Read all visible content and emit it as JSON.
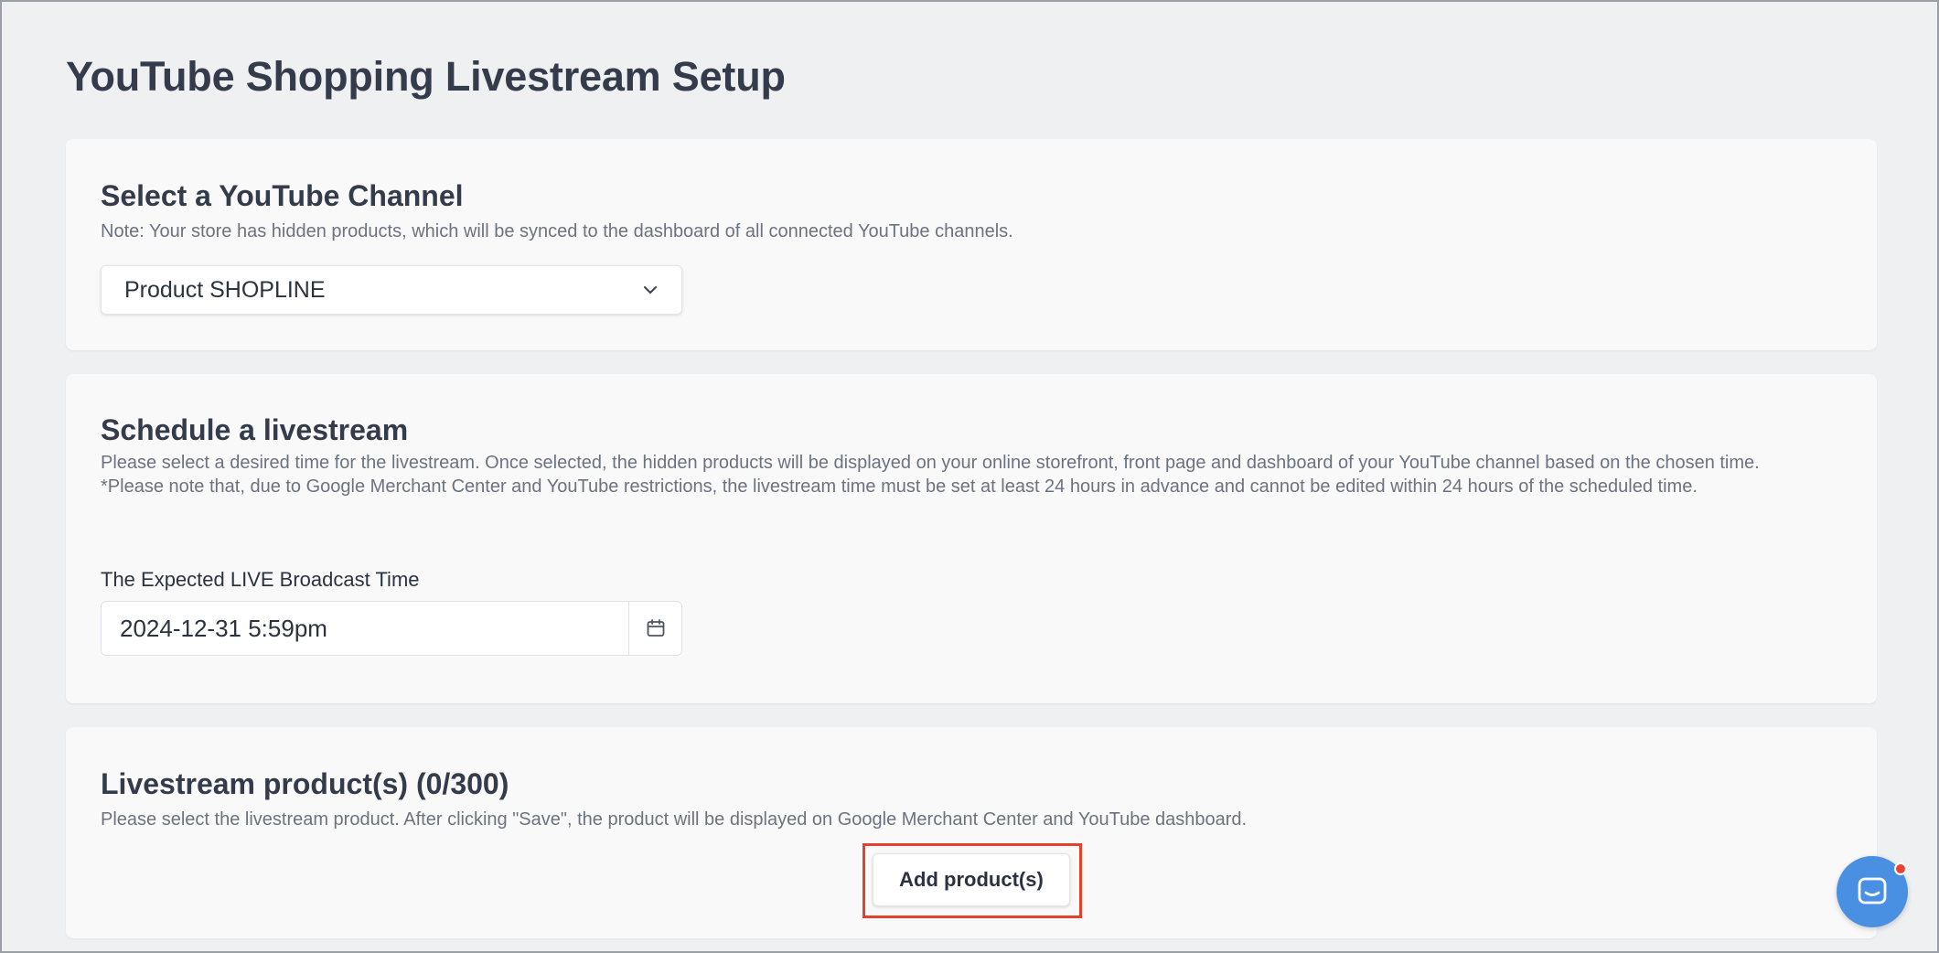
{
  "page": {
    "title": "YouTube Shopping Livestream Setup"
  },
  "channel": {
    "heading": "Select a YouTube Channel",
    "note": "Note: Your store has hidden products, which will be synced to the dashboard of all connected YouTube channels.",
    "selected": "Product SHOPLINE",
    "icon": "chevron-down-icon"
  },
  "schedule": {
    "heading": "Schedule a livestream",
    "description": "Please select a desired time for the livestream. Once selected, the hidden products will be displayed on your online storefront, front page and dashboard of your YouTube channel based on the chosen time.",
    "restriction": "*Please note that, due to Google Merchant Center and YouTube restrictions, the livestream time must be set at least 24 hours in advance and cannot be edited within 24 hours of the scheduled time.",
    "field_label": "The Expected LIVE Broadcast Time",
    "value": "2024-12-31 5:59pm",
    "icon": "calendar-icon"
  },
  "products": {
    "heading": "Livestream product(s) (0/300)",
    "description": "Please select the livestream product. After clicking \"Save\", the product will be displayed on Google Merchant Center and YouTube dashboard.",
    "add_label": "Add product(s)",
    "highlight_color": "#e0422a"
  },
  "chat": {
    "icon": "chat-icon",
    "color": "#4a90e2",
    "badge_color": "#ea4335"
  }
}
